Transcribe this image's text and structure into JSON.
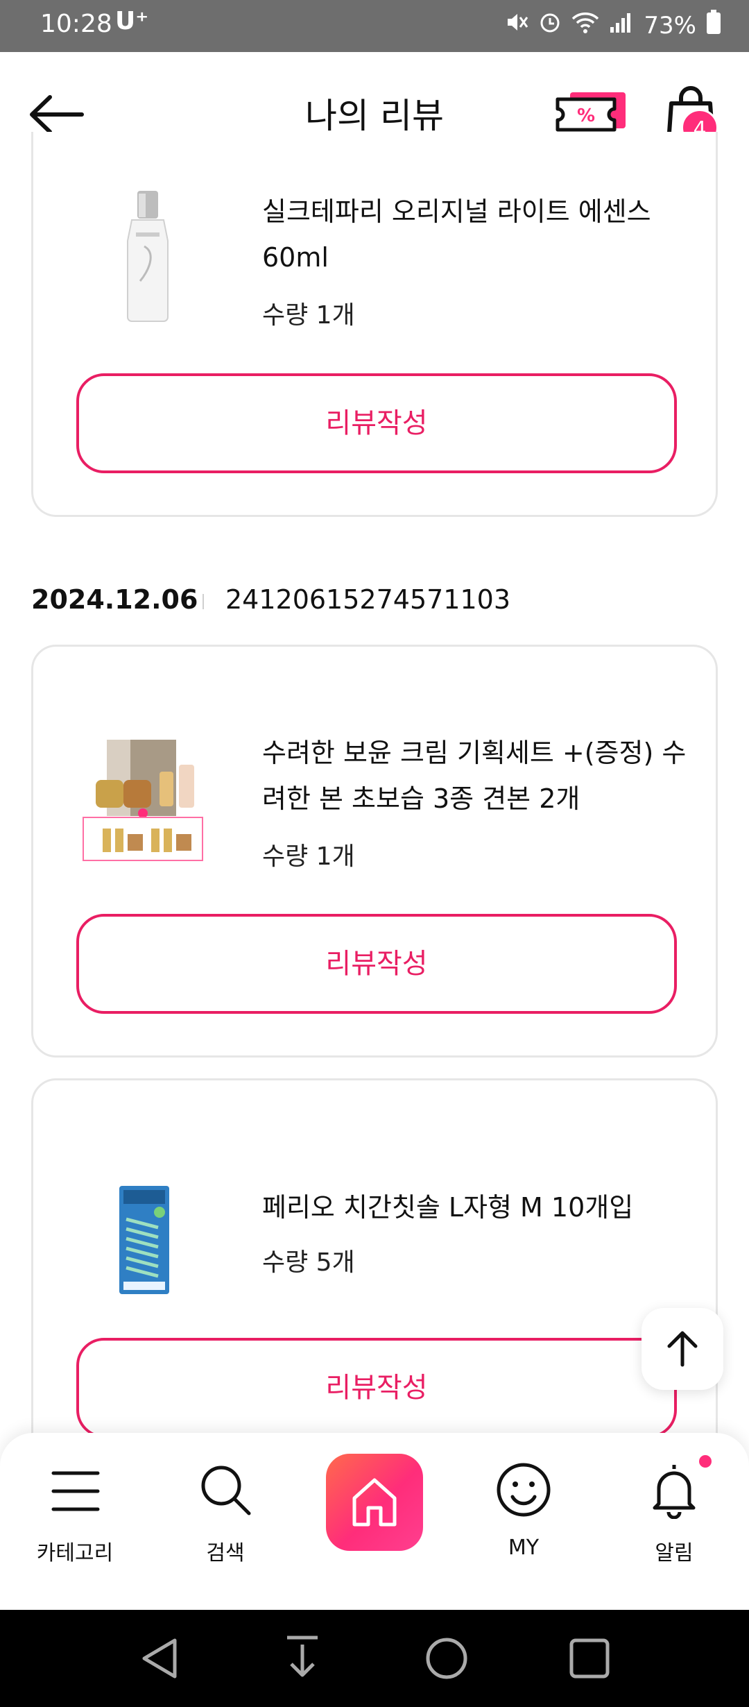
{
  "status_bar": {
    "time": "10:28",
    "carrier": "U⁺",
    "battery_percent": "73%"
  },
  "header": {
    "title": "나의 리뷰",
    "cart_count": "4"
  },
  "cards": [
    {
      "product_name": "실크테파리 오리지널 라이트 에센스 60ml",
      "quantity": "수량 1개",
      "review_button": "리뷰작성",
      "thumbnail": "essence-bottle-image"
    },
    {
      "product_name": "수려한 보윤 크림 기획세트 +(증정) 수려한 본 초보습 3종 견본 2개",
      "quantity": "수량 1개",
      "review_button": "리뷰작성",
      "thumbnail": "cream-set-image"
    },
    {
      "product_name": "페리오 치간칫솔 L자형 M 10개입",
      "quantity": "수량 5개",
      "review_button": "리뷰작성",
      "thumbnail": "interdental-brush-image"
    }
  ],
  "order": {
    "date": "2024.12.06",
    "number": "24120615274571103"
  },
  "bottom_nav": {
    "items": [
      {
        "label": "카테고리",
        "icon": "menu-icon"
      },
      {
        "label": "검색",
        "icon": "search-icon"
      },
      {
        "label": "",
        "icon": "home-icon"
      },
      {
        "label": "MY",
        "icon": "smiley-icon"
      },
      {
        "label": "알림",
        "icon": "bell-icon"
      }
    ]
  },
  "colors": {
    "accent": "#e91e63",
    "badge": "#ff2d7a",
    "status_bar": "#6e6e6e"
  }
}
